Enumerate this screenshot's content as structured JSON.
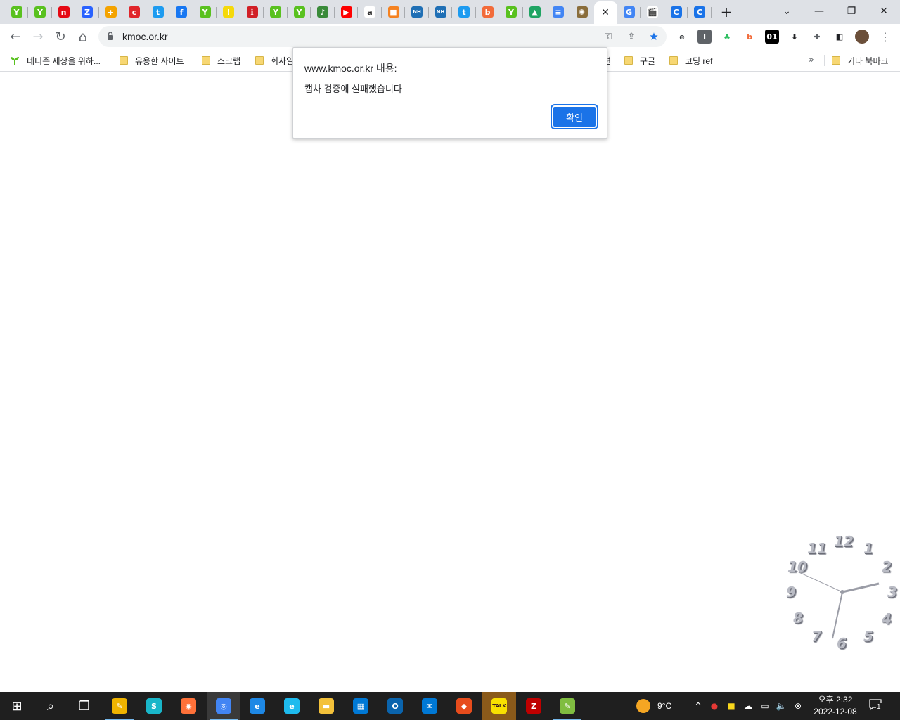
{
  "window": {
    "minimize_glyph": "—",
    "restore_glyph": "❐",
    "close_glyph": "✕",
    "tab_search_glyph": "⌄",
    "new_tab_glyph": "+"
  },
  "tabs": [
    {
      "icon": "naver-sprout-icon",
      "glyph": "Y",
      "color": "#59c11f"
    },
    {
      "icon": "naver-sprout-icon",
      "glyph": "Y",
      "color": "#59c11f"
    },
    {
      "icon": "netflix-n-icon",
      "glyph": "n",
      "color": "#e50914"
    },
    {
      "icon": "zum-z-icon",
      "glyph": "Z",
      "color": "#2962ff"
    },
    {
      "icon": "plus-colored-icon",
      "glyph": "+",
      "color": "#f4a300"
    },
    {
      "icon": "red-swoosh-icon",
      "glyph": "c",
      "color": "#e0262b"
    },
    {
      "icon": "twitter-bird-icon",
      "glyph": "t",
      "color": "#1d9bf0"
    },
    {
      "icon": "facebook-icon",
      "glyph": "f",
      "color": "#1877f2"
    },
    {
      "icon": "naver-sprout-icon",
      "glyph": "Y",
      "color": "#59c11f"
    },
    {
      "icon": "yellow-note-icon",
      "glyph": "!",
      "color": "#f5d90a"
    },
    {
      "icon": "red-bookmark-icon",
      "glyph": "ℹ",
      "color": "#d11f26"
    },
    {
      "icon": "naver-sprout-icon",
      "glyph": "Y",
      "color": "#59c11f"
    },
    {
      "icon": "naver-sprout-icon",
      "glyph": "Y",
      "color": "#59c11f"
    },
    {
      "icon": "green-pen-icon",
      "glyph": "♪",
      "color": "#3a8b3a"
    },
    {
      "icon": "youtube-icon",
      "glyph": "▶",
      "color": "#ff0000"
    },
    {
      "icon": "amazon-icon",
      "glyph": "a",
      "color": "#222222"
    },
    {
      "icon": "orange-box-icon",
      "glyph": "■",
      "color": "#f58220"
    },
    {
      "icon": "nh-bank-icon",
      "glyph": "NH",
      "color": "#1f6fb5"
    },
    {
      "icon": "nh-bank-icon",
      "glyph": "NH",
      "color": "#1f6fb5"
    },
    {
      "icon": "twitter-square-icon",
      "glyph": "t",
      "color": "#1d9bf0"
    },
    {
      "icon": "orange-b-icon",
      "glyph": "b",
      "color": "#f26b3a"
    },
    {
      "icon": "naver-sprout-icon",
      "glyph": "Y",
      "color": "#59c11f"
    },
    {
      "icon": "google-drive-icon",
      "glyph": "▲",
      "color": "#1fa463"
    },
    {
      "icon": "google-docs-icon",
      "glyph": "≡",
      "color": "#4285f4"
    },
    {
      "icon": "seal-emblem-icon",
      "glyph": "✺",
      "color": "#8a6d3b"
    },
    {
      "icon": "close-tab-icon",
      "glyph": "✕",
      "color": "#202124",
      "active": true
    },
    {
      "icon": "google-g-icon",
      "glyph": "G",
      "color": "#4285f4"
    },
    {
      "icon": "film-clapper-icon",
      "glyph": "🎬",
      "color": "#333333"
    },
    {
      "icon": "blue-c-icon",
      "glyph": "C",
      "color": "#1a73e8"
    },
    {
      "icon": "blue-c-icon",
      "glyph": "C",
      "color": "#1a73e8"
    }
  ],
  "toolbar": {
    "back_glyph": "←",
    "forward_glyph": "→",
    "reload_glyph": "↻",
    "home_glyph": "⌂",
    "url": "kmoc.or.kr",
    "key_glyph": "⚿",
    "share_glyph": "⇪",
    "star_glyph": "★",
    "menu_glyph": "⋮",
    "extensions": [
      {
        "icon": "extension-e-icon",
        "glyph": "e",
        "color": "#3c4043"
      },
      {
        "icon": "extension-i-icon",
        "glyph": "I",
        "color": "#5f6368"
      },
      {
        "icon": "evernote-icon",
        "glyph": "♣",
        "color": "#2dbe60"
      },
      {
        "icon": "extension-b-icon",
        "glyph": "b",
        "color": "#f26b3a"
      },
      {
        "icon": "extension-01-icon",
        "glyph": "01",
        "color": "#000000"
      },
      {
        "icon": "download-arrow-icon",
        "glyph": "⬇",
        "color": "#202124"
      },
      {
        "icon": "puzzle-icon",
        "glyph": "✚",
        "color": "#5f6368"
      },
      {
        "icon": "side-panel-icon",
        "glyph": "◧",
        "color": "#202124"
      },
      {
        "icon": "profile-avatar-icon",
        "glyph": "●",
        "color": "#6b4f3a"
      }
    ]
  },
  "bookmarks": {
    "items": [
      {
        "label": "네티즌 세상을 위하...",
        "type": "sprout"
      },
      {
        "label": "유용한 사이트",
        "type": "folder"
      },
      {
        "label": "스크랩",
        "type": "folder"
      },
      {
        "label": "회사일",
        "type": "folder"
      },
      {
        "label": "련",
        "type": "folder"
      },
      {
        "label": "구글",
        "type": "folder"
      },
      {
        "label": "코딩 ref",
        "type": "folder"
      }
    ],
    "overflow_glyph": "»",
    "other_bookmarks": "기타 북마크"
  },
  "dialog": {
    "title": "www.kmoc.or.kr 내용:",
    "message": "캡차 검증에 실패했습니다",
    "ok_label": "확인"
  },
  "clock_widget": {
    "numbers": [
      "12",
      "1",
      "2",
      "3",
      "4",
      "5",
      "6",
      "7",
      "8",
      "9",
      "10",
      "11"
    ]
  },
  "taskbar": {
    "apps": [
      {
        "icon": "windows-start-icon",
        "glyph": "⊞",
        "color": "#ffffff"
      },
      {
        "icon": "search-icon",
        "glyph": "⌕",
        "color": "#ffffff"
      },
      {
        "icon": "task-view-icon",
        "glyph": "❐",
        "color": "#ffffff"
      },
      {
        "icon": "pen-app-icon",
        "glyph": "✎",
        "color": "#f0b400"
      },
      {
        "icon": "teal-app-icon",
        "glyph": "S",
        "color": "#19b6c9"
      },
      {
        "icon": "firefox-icon",
        "glyph": "◉",
        "color": "#ff7139"
      },
      {
        "icon": "chrome-icon",
        "glyph": "◎",
        "color": "#4285f4"
      },
      {
        "icon": "edge-icon",
        "glyph": "e",
        "color": "#1e88e5"
      },
      {
        "icon": "internet-explorer-icon",
        "glyph": "e",
        "color": "#1ebbee"
      },
      {
        "icon": "file-explorer-icon",
        "glyph": "▬",
        "color": "#f3c13a"
      },
      {
        "icon": "microsoft-store-icon",
        "glyph": "▦",
        "color": "#0078d4"
      },
      {
        "icon": "outlook-icon",
        "glyph": "O",
        "color": "#0a64ad"
      },
      {
        "icon": "mail-icon",
        "glyph": "✉",
        "color": "#0078d4"
      },
      {
        "icon": "office-icon",
        "glyph": "◆",
        "color": "#e74c1c"
      },
      {
        "icon": "kakaotalk-icon",
        "glyph": "TALK",
        "color": "#3c1e1e"
      },
      {
        "icon": "filezilla-icon",
        "glyph": "Z",
        "color": "#bf0000"
      },
      {
        "icon": "notepad-plus-icon",
        "glyph": "✎",
        "color": "#80bd41"
      }
    ],
    "weather": "9°C",
    "time_period": "오후 2:32",
    "date": "2022-12-08",
    "notification_count": "1",
    "tray_up_glyph": "^"
  }
}
